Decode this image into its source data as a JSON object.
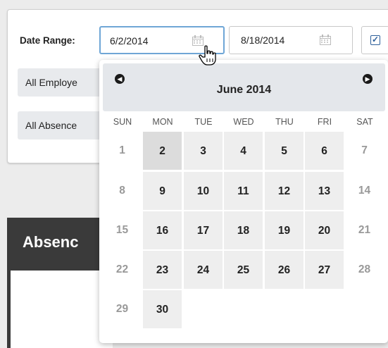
{
  "filters": {
    "date_range_label": "Date Range:",
    "start_date": "6/2/2014",
    "end_date": "8/18/2014",
    "checkbox_checked": true,
    "employee_select": "All Employe",
    "absence_select": "All Absence"
  },
  "report": {
    "title": "Absenc"
  },
  "calendar": {
    "month_title": "June 2014",
    "prev_icon": "chevron-left-icon",
    "next_icon": "chevron-right-icon",
    "weekday_headers": [
      "SUN",
      "MON",
      "TUE",
      "WED",
      "THU",
      "FRI",
      "SAT"
    ],
    "weeks": [
      [
        "1",
        "2",
        "3",
        "4",
        "5",
        "6",
        "7"
      ],
      [
        "8",
        "9",
        "10",
        "11",
        "12",
        "13",
        "14"
      ],
      [
        "15",
        "16",
        "17",
        "18",
        "19",
        "20",
        "21"
      ],
      [
        "22",
        "23",
        "24",
        "25",
        "26",
        "27",
        "28"
      ],
      [
        "29",
        "30"
      ]
    ],
    "selected_day": "2"
  },
  "colors": {
    "active_border": "#6fa6d6",
    "checkbox_accent": "#2d5f9a",
    "header_dark": "#3a3a3a"
  }
}
